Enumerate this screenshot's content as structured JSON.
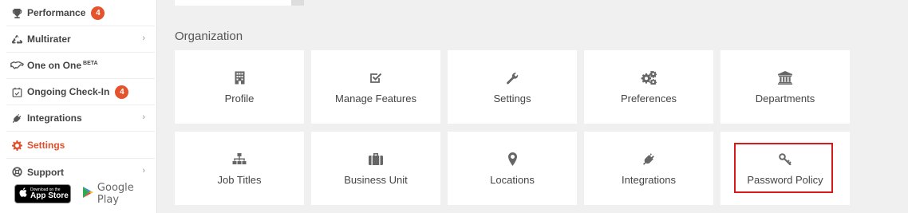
{
  "sidebar": {
    "items": [
      {
        "name": "performance",
        "label": "Performance",
        "badge": "4",
        "icon": "trophy-icon"
      },
      {
        "name": "multirater",
        "label": "Multirater",
        "icon": "recycle-icon",
        "chevron": "›"
      },
      {
        "name": "one-on-one",
        "label": "One on One",
        "sup": "BETA",
        "icon": "handshake-icon"
      },
      {
        "name": "ongoing-check-in",
        "label": "Ongoing Check-In",
        "badge": "4",
        "icon": "calendar-check-icon"
      },
      {
        "name": "integrations",
        "label": "Integrations",
        "icon": "plug-icon",
        "chevron": "›"
      },
      {
        "name": "settings",
        "label": "Settings",
        "icon": "gear-icon",
        "active": true
      },
      {
        "name": "support",
        "label": "Support",
        "icon": "lifebuoy-icon",
        "chevron": "›"
      }
    ],
    "app_store": {
      "small": "Download on the",
      "big": "App Store"
    },
    "google_play": "Google Play"
  },
  "main": {
    "section_title": "Organization",
    "cards": [
      {
        "label": "Profile",
        "icon": "building-icon"
      },
      {
        "label": "Manage Features",
        "icon": "check-square-icon"
      },
      {
        "label": "Settings",
        "icon": "wrench-icon"
      },
      {
        "label": "Preferences",
        "icon": "cogs-icon"
      },
      {
        "label": "Departments",
        "icon": "institution-icon"
      },
      {
        "label": "Job Titles",
        "icon": "sitemap-icon"
      },
      {
        "label": "Business Unit",
        "icon": "briefcase-icon"
      },
      {
        "label": "Locations",
        "icon": "map-marker-icon"
      },
      {
        "label": "Integrations",
        "icon": "plug-icon"
      },
      {
        "label": "Password Policy",
        "icon": "key-icon",
        "highlighted": true
      }
    ]
  },
  "colors": {
    "accent": "#e0502c",
    "badge": "#e4532b",
    "highlight_border": "#d61a1a",
    "background": "#f0f0f0"
  }
}
